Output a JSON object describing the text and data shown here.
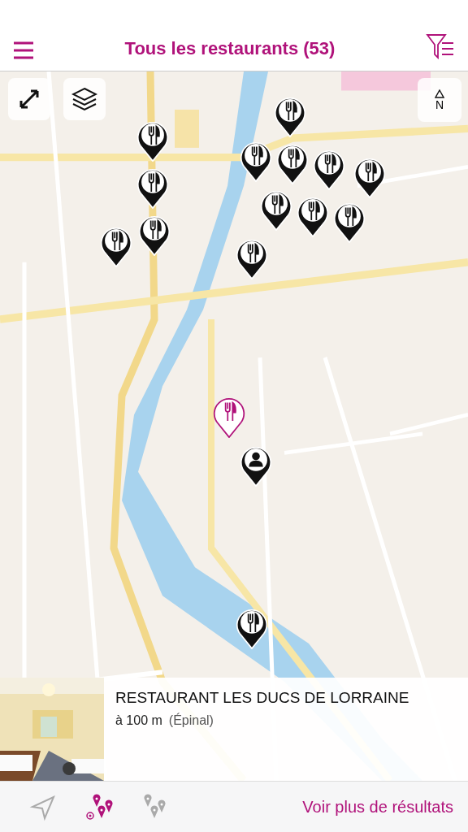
{
  "header": {
    "title": "Tous les restaurants (53)"
  },
  "map": {
    "compass_label": "N",
    "pins": [
      {
        "kind": "restaurant",
        "selected": false
      },
      {
        "kind": "restaurant",
        "selected": false
      },
      {
        "kind": "restaurant",
        "selected": false
      },
      {
        "kind": "restaurant",
        "selected": false
      },
      {
        "kind": "restaurant",
        "selected": false
      },
      {
        "kind": "restaurant",
        "selected": false
      },
      {
        "kind": "restaurant",
        "selected": false
      },
      {
        "kind": "restaurant",
        "selected": false
      },
      {
        "kind": "restaurant",
        "selected": false
      },
      {
        "kind": "restaurant",
        "selected": false
      },
      {
        "kind": "restaurant",
        "selected": false
      },
      {
        "kind": "restaurant",
        "selected": false
      },
      {
        "kind": "restaurant",
        "selected": false
      },
      {
        "kind": "restaurant",
        "selected": true
      },
      {
        "kind": "user",
        "selected": false
      },
      {
        "kind": "restaurant",
        "selected": false
      }
    ]
  },
  "card": {
    "name": "RESTAURANT LES DUCS DE LORRAINE",
    "distance": "à 100 m",
    "city": "(Épinal)"
  },
  "bottom_bar": {
    "modes": [
      {
        "kind": "locate",
        "selected": false
      },
      {
        "kind": "map",
        "selected": true
      },
      {
        "kind": "list",
        "selected": false
      }
    ],
    "more_link": "Voir plus de résultats"
  }
}
